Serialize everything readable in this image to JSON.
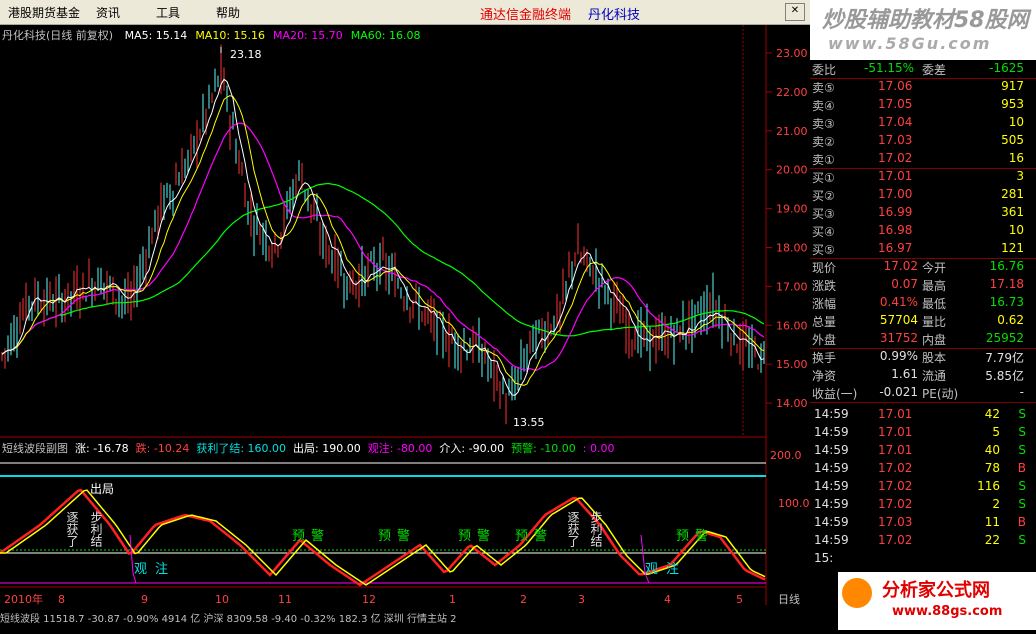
{
  "menu": {
    "items": [
      "港股期货基金",
      "资讯",
      "工具",
      "帮助"
    ],
    "brand_left": "通达信金融终端",
    "brand_right": "丹化科技"
  },
  "watermark": {
    "top_name": "炒股辅助教材58股网",
    "top_url": "www.58Gu.com",
    "bottom_name": "分析家公式网",
    "bottom_url": "www.88gs.com"
  },
  "chart": {
    "header": {
      "title": "丹化科技(日线 前复权)",
      "ma": [
        {
          "label": "MA5: 15.14",
          "color": "#ffffff"
        },
        {
          "label": "MA10: 15.16",
          "color": "#ffff00"
        },
        {
          "label": "MA20: 15.70",
          "color": "#ff00ff"
        },
        {
          "label": "MA60: 16.08",
          "color": "#00ff00"
        }
      ]
    },
    "price_axis": [
      "23.00",
      "22.00",
      "21.00",
      "20.00",
      "19.00",
      "18.00",
      "17.00",
      "16.00",
      "15.00",
      "14.00"
    ],
    "high_label": "23.18",
    "low_label": "13.55",
    "ind_header": [
      {
        "text": "短线波段副图",
        "color": "#c0c0c0"
      },
      {
        "text": "涨: -16.78",
        "color": "#ffffff"
      },
      {
        "text": "跌: -10.24",
        "color": "#ff4040"
      },
      {
        "text": "获利了结: 160.00",
        "color": "#00e0e0"
      },
      {
        "text": "出局: 190.00",
        "color": "#ffffff"
      },
      {
        "text": "观注: -80.00",
        "color": "#ff00ff"
      },
      {
        "text": "介入: -90.00",
        "color": "#ffffff"
      },
      {
        "text": "预警: -10.00",
        "color": "#00e000"
      },
      {
        "text": ": 0.00",
        "color": "#ff00ff"
      }
    ],
    "ind_axis": [
      "200.0",
      "100.0"
    ],
    "signals": {
      "chuju": "出局",
      "zhuhuo": "逐获了",
      "buli": "步利结",
      "guanzhu": "观注",
      "yujing": "预警"
    },
    "date_axis": [
      "2010年",
      "8",
      "9",
      "10",
      "11",
      "12",
      "1",
      "2",
      "3",
      "4",
      "5"
    ],
    "period_label": "日线",
    "footer_text": "短线波段  11518.7  -30.87  -0.90%    4914 亿 沪深  8309.58  -9.40  -0.32%  182.3 亿   深圳 行情主站 2"
  },
  "quote": {
    "weibi": {
      "label": "委比",
      "value": "-51.15%",
      "label2": "委差",
      "value2": "-1625"
    },
    "sell": [
      {
        "label": "卖⑤",
        "price": "17.06",
        "vol": "917"
      },
      {
        "label": "卖④",
        "price": "17.05",
        "vol": "953"
      },
      {
        "label": "卖③",
        "price": "17.04",
        "vol": "10"
      },
      {
        "label": "卖②",
        "price": "17.03",
        "vol": "505"
      },
      {
        "label": "卖①",
        "price": "17.02",
        "vol": "16"
      }
    ],
    "buy": [
      {
        "label": "买①",
        "price": "17.01",
        "vol": "3"
      },
      {
        "label": "买②",
        "price": "17.00",
        "vol": "281"
      },
      {
        "label": "买③",
        "price": "16.99",
        "vol": "361"
      },
      {
        "label": "买④",
        "price": "16.98",
        "vol": "10"
      },
      {
        "label": "买⑤",
        "price": "16.97",
        "vol": "121"
      }
    ],
    "stats": [
      {
        "l1": "现价",
        "v1": "17.02",
        "c1": "red",
        "l2": "今开",
        "v2": "16.76",
        "c2": "green"
      },
      {
        "l1": "涨跌",
        "v1": "0.07",
        "c1": "red",
        "l2": "最高",
        "v2": "17.18",
        "c2": "red"
      },
      {
        "l1": "涨幅",
        "v1": "0.41%",
        "c1": "red",
        "l2": "最低",
        "v2": "16.73",
        "c2": "green"
      },
      {
        "l1": "总量",
        "v1": "57704",
        "c1": "yellow",
        "l2": "量比",
        "v2": "0.62",
        "c2": "yellow"
      },
      {
        "l1": "外盘",
        "v1": "31752",
        "c1": "red",
        "l2": "内盘",
        "v2": "25952",
        "c2": "green"
      }
    ],
    "finance": [
      {
        "l1": "换手",
        "v1": "0.99%",
        "l2": "股本",
        "v2": "7.79亿"
      },
      {
        "l1": "净资",
        "v1": "1.61",
        "l2": "流通",
        "v2": "5.85亿"
      },
      {
        "l1": "收益(一)",
        "v1": "-0.021",
        "l2": "PE(动)",
        "v2": "-"
      }
    ],
    "ticks": [
      {
        "time": "14:59",
        "price": "17.01",
        "vol": "42",
        "flag": "S"
      },
      {
        "time": "14:59",
        "price": "17.01",
        "vol": "5",
        "flag": "S"
      },
      {
        "time": "14:59",
        "price": "17.01",
        "vol": "40",
        "flag": "S"
      },
      {
        "time": "14:59",
        "price": "17.02",
        "vol": "78",
        "flag": "B"
      },
      {
        "time": "14:59",
        "price": "17.02",
        "vol": "116",
        "flag": "S"
      },
      {
        "time": "14:59",
        "price": "17.02",
        "vol": "2",
        "flag": "S"
      },
      {
        "time": "14:59",
        "price": "17.03",
        "vol": "11",
        "flag": "B"
      },
      {
        "time": "14:59",
        "price": "17.02",
        "vol": "22",
        "flag": "S"
      },
      {
        "time": "15:",
        "price": "",
        "vol": "",
        "flag": ""
      }
    ]
  }
}
